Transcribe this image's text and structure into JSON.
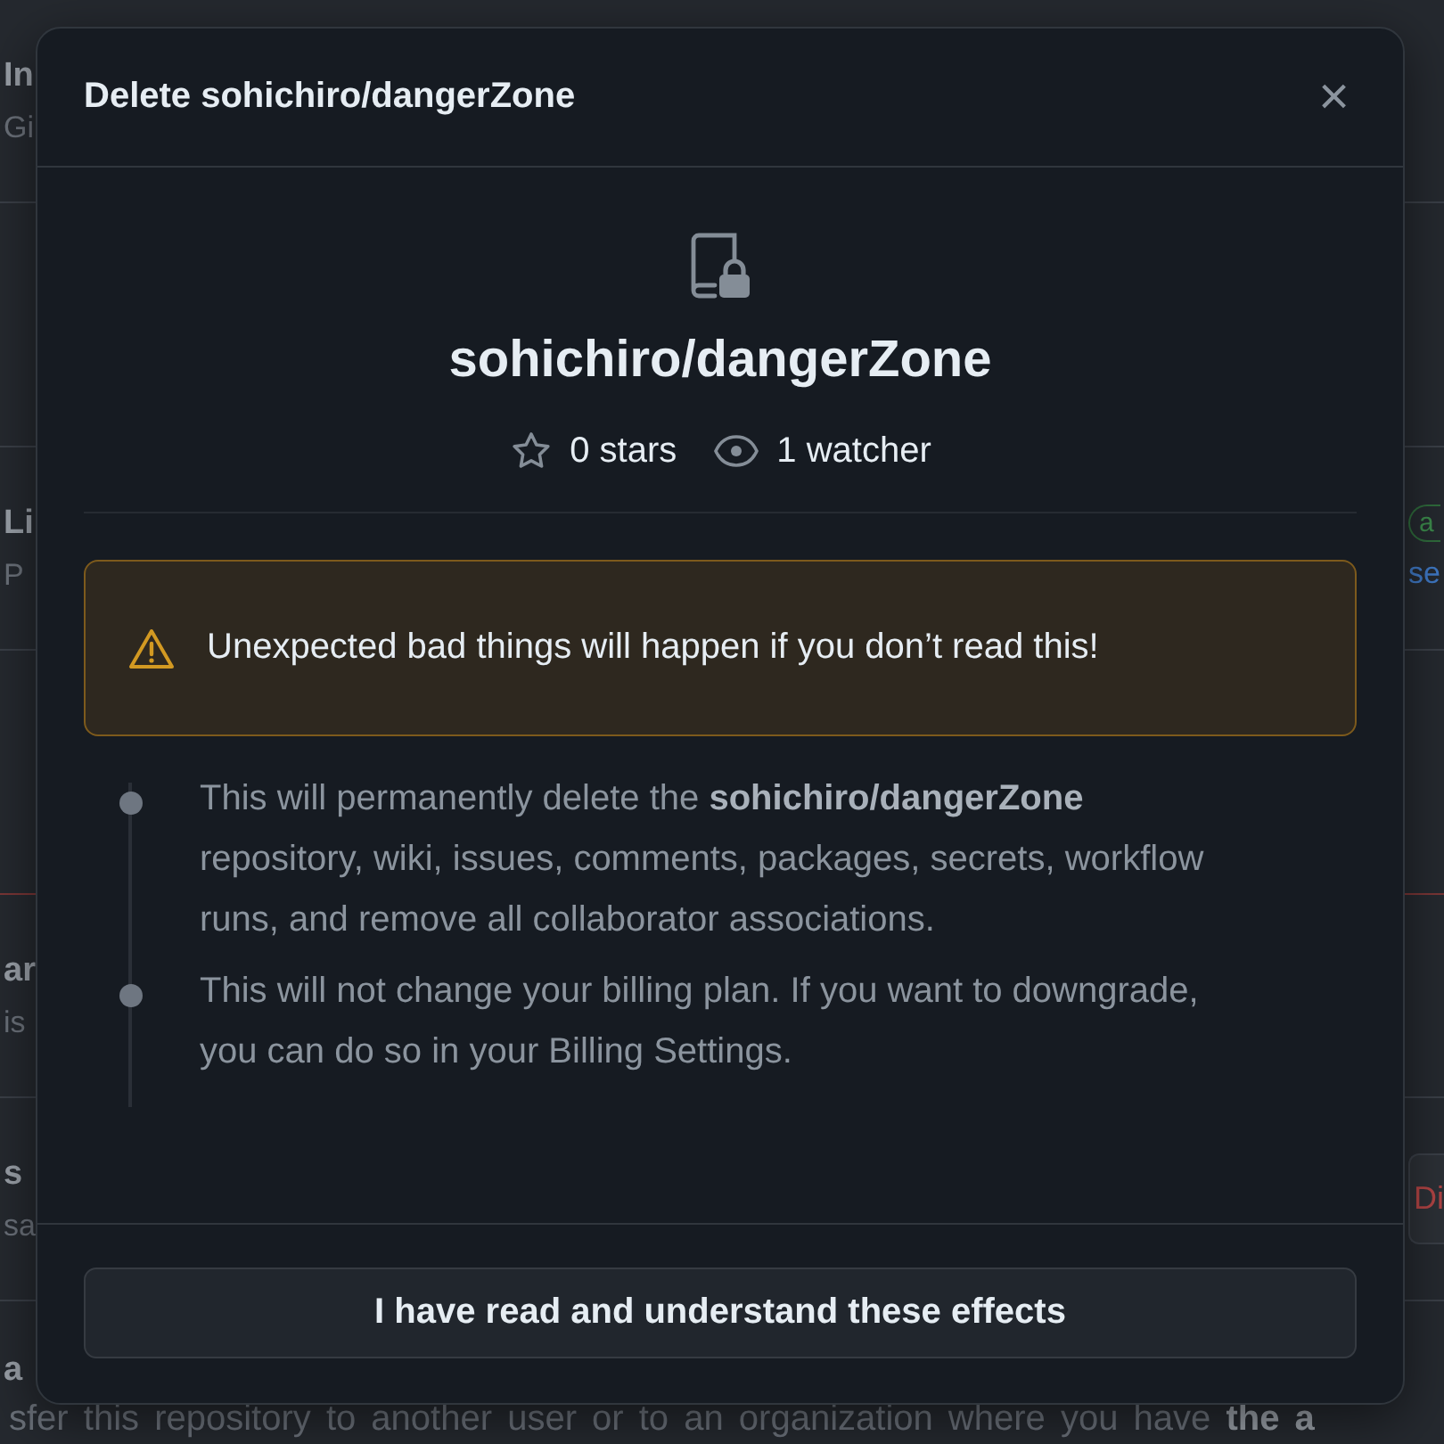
{
  "background": {
    "rows": [
      {
        "kind": "setting",
        "title": "In",
        "subtitle": "Gi"
      },
      {
        "kind": "heading",
        "danger": false
      },
      {
        "kind": "setting",
        "title": "Li",
        "subtitle": "P",
        "badge": "a",
        "link": "se"
      },
      {
        "kind": "heading",
        "danger": true
      },
      {
        "kind": "setting",
        "title": "ar",
        "subtitle": "is"
      },
      {
        "kind": "setting",
        "title": "s",
        "subtitle": "sa",
        "action": "Di"
      },
      {
        "kind": "setting",
        "title": "a",
        "subtitle": "sfer this repository to another user or to an organization where you have **the a**"
      }
    ]
  },
  "dialog": {
    "title": "Delete sohichiro/dangerZone",
    "close": "×",
    "repo": "sohichiro/dangerZone",
    "stars": "0 stars",
    "watchers": "1 watcher",
    "warning": "Unexpected bad things will happen if you don’t read this!",
    "effects": [
      "This will permanently delete the **sohichiro/dangerZone** repository, wiki, issues, comments, packages, secrets, workflow runs, and remove all collaborator associations.",
      "This will not change your billing plan. If you want to downgrade, you can do so in your Billing Settings."
    ],
    "confirm": "I have read and understand these effects"
  }
}
